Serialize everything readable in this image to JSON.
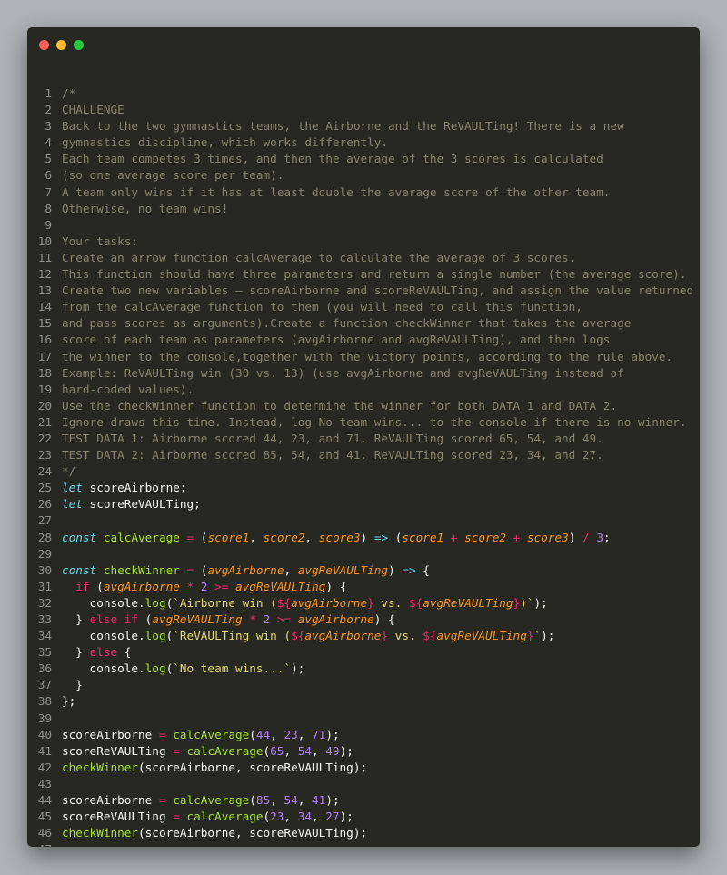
{
  "window_controls": {
    "close": "close-dot",
    "minimize": "minimize-dot",
    "zoom": "zoom-dot"
  },
  "colors": {
    "background": "#272822",
    "comment": "#88846f",
    "keyword": "#66d9ef",
    "operator": "#f92672",
    "function": "#a6e22e",
    "parameter": "#fd971f",
    "number": "#ae81ff",
    "string": "#e6db74",
    "plain": "#f8f8f2"
  },
  "code_lines": [
    [
      [
        "comment",
        "/*"
      ]
    ],
    [
      [
        "comment",
        "CHALLENGE"
      ]
    ],
    [
      [
        "comment",
        "Back to the two gymnastics teams, the Airborne and the ReVAULTing! There is a new"
      ]
    ],
    [
      [
        "comment",
        "gymnastics discipline, which works differently."
      ]
    ],
    [
      [
        "comment",
        "Each team competes 3 times, and then the average of the 3 scores is calculated"
      ]
    ],
    [
      [
        "comment",
        "(so one average score per team)."
      ]
    ],
    [
      [
        "comment",
        "A team only wins if it has at least double the average score of the other team."
      ]
    ],
    [
      [
        "comment",
        "Otherwise, no team wins!"
      ]
    ],
    [],
    [
      [
        "comment",
        "Your tasks:"
      ]
    ],
    [
      [
        "comment",
        "Create an arrow function calcAverage to calculate the average of 3 scores."
      ]
    ],
    [
      [
        "comment",
        "This function should have three parameters and return a single number (the average score)."
      ]
    ],
    [
      [
        "comment",
        "Create two new variables — scoreAirborne and scoreReVAULTing, and assign the value returned"
      ]
    ],
    [
      [
        "comment",
        "from the calcAverage function to them (you will need to call this function,"
      ]
    ],
    [
      [
        "comment",
        "and pass scores as arguments).Create a function checkWinner that takes the average"
      ]
    ],
    [
      [
        "comment",
        "score of each team as parameters (avgAirborne and avgReVAULTing), and then logs"
      ]
    ],
    [
      [
        "comment",
        "the winner to the console,together with the victory points, according to the rule above."
      ]
    ],
    [
      [
        "comment",
        "Example: ReVAULTing win (30 vs. 13) (use avgAirborne and avgReVAULTing instead of"
      ]
    ],
    [
      [
        "comment",
        "hard-coded values)."
      ]
    ],
    [
      [
        "comment",
        "Use the checkWinner function to determine the winner for both DATA 1 and DATA 2."
      ]
    ],
    [
      [
        "comment",
        "Ignore draws this time. Instead, log No team wins... to the console if there is no winner."
      ]
    ],
    [
      [
        "comment",
        "TEST DATA 1: Airborne scored 44, 23, and 71. ReVAULTing scored 65, 54, and 49."
      ]
    ],
    [
      [
        "comment",
        "TEST DATA 2: Airborne scored 85, 54, and 41. ReVAULTing scored 23, 34, and 27."
      ]
    ],
    [
      [
        "comment",
        "*/"
      ]
    ],
    [
      [
        "keyword",
        "let"
      ],
      [
        "plain",
        " scoreAirborne;"
      ]
    ],
    [
      [
        "keyword",
        "let"
      ],
      [
        "plain",
        " scoreReVAULTing;"
      ]
    ],
    [],
    [
      [
        "keyword",
        "const"
      ],
      [
        "plain",
        " "
      ],
      [
        "fn",
        "calcAverage"
      ],
      [
        "plain",
        " "
      ],
      [
        "op",
        "="
      ],
      [
        "plain",
        " ("
      ],
      [
        "param",
        "score1"
      ],
      [
        "plain",
        ", "
      ],
      [
        "param",
        "score2"
      ],
      [
        "plain",
        ", "
      ],
      [
        "param",
        "score3"
      ],
      [
        "plain",
        ") "
      ],
      [
        "arrow",
        "=>"
      ],
      [
        "plain",
        " ("
      ],
      [
        "param",
        "score1"
      ],
      [
        "plain",
        " "
      ],
      [
        "op",
        "+"
      ],
      [
        "plain",
        " "
      ],
      [
        "param",
        "score2"
      ],
      [
        "plain",
        " "
      ],
      [
        "op",
        "+"
      ],
      [
        "plain",
        " "
      ],
      [
        "param",
        "score3"
      ],
      [
        "plain",
        ") "
      ],
      [
        "op",
        "/"
      ],
      [
        "plain",
        " "
      ],
      [
        "num",
        "3"
      ],
      [
        "plain",
        ";"
      ]
    ],
    [],
    [
      [
        "keyword",
        "const"
      ],
      [
        "plain",
        " "
      ],
      [
        "fn",
        "checkWinner"
      ],
      [
        "plain",
        " "
      ],
      [
        "op",
        "="
      ],
      [
        "plain",
        " ("
      ],
      [
        "param",
        "avgAirborne"
      ],
      [
        "plain",
        ", "
      ],
      [
        "param",
        "avgReVAULTing"
      ],
      [
        "plain",
        ") "
      ],
      [
        "arrow",
        "=>"
      ],
      [
        "plain",
        " {"
      ]
    ],
    [
      [
        "plain",
        "  "
      ],
      [
        "ctrl",
        "if"
      ],
      [
        "plain",
        " ("
      ],
      [
        "param",
        "avgAirborne"
      ],
      [
        "plain",
        " "
      ],
      [
        "op",
        "*"
      ],
      [
        "plain",
        " "
      ],
      [
        "num",
        "2"
      ],
      [
        "plain",
        " "
      ],
      [
        "op",
        ">="
      ],
      [
        "plain",
        " "
      ],
      [
        "param",
        "avgReVAULTing"
      ],
      [
        "plain",
        ") {"
      ]
    ],
    [
      [
        "plain",
        "    console."
      ],
      [
        "fn",
        "log"
      ],
      [
        "plain",
        "("
      ],
      [
        "str",
        "`Airborne win ("
      ],
      [
        "tpl",
        "${"
      ],
      [
        "param",
        "avgAirborne"
      ],
      [
        "tpl",
        "}"
      ],
      [
        "str",
        " vs. "
      ],
      [
        "tpl",
        "${"
      ],
      [
        "param",
        "avgReVAULTing"
      ],
      [
        "tpl",
        "}"
      ],
      [
        "str",
        ")`"
      ],
      [
        "plain",
        ");"
      ]
    ],
    [
      [
        "plain",
        "  } "
      ],
      [
        "ctrl",
        "else"
      ],
      [
        "plain",
        " "
      ],
      [
        "ctrl",
        "if"
      ],
      [
        "plain",
        " ("
      ],
      [
        "param",
        "avgReVAULTing"
      ],
      [
        "plain",
        " "
      ],
      [
        "op",
        "*"
      ],
      [
        "plain",
        " "
      ],
      [
        "num",
        "2"
      ],
      [
        "plain",
        " "
      ],
      [
        "op",
        ">="
      ],
      [
        "plain",
        " "
      ],
      [
        "param",
        "avgAirborne"
      ],
      [
        "plain",
        ") {"
      ]
    ],
    [
      [
        "plain",
        "    console."
      ],
      [
        "fn",
        "log"
      ],
      [
        "plain",
        "("
      ],
      [
        "str",
        "`ReVAULTing win ("
      ],
      [
        "tpl",
        "${"
      ],
      [
        "param",
        "avgAirborne"
      ],
      [
        "tpl",
        "}"
      ],
      [
        "str",
        " vs. "
      ],
      [
        "tpl",
        "${"
      ],
      [
        "param",
        "avgReVAULTing"
      ],
      [
        "tpl",
        "}"
      ],
      [
        "str",
        "`"
      ],
      [
        "plain",
        ");"
      ]
    ],
    [
      [
        "plain",
        "  } "
      ],
      [
        "ctrl",
        "else"
      ],
      [
        "plain",
        " {"
      ]
    ],
    [
      [
        "plain",
        "    console."
      ],
      [
        "fn",
        "log"
      ],
      [
        "plain",
        "("
      ],
      [
        "str",
        "`No team wins...`"
      ],
      [
        "plain",
        ");"
      ]
    ],
    [
      [
        "plain",
        "  }"
      ]
    ],
    [
      [
        "plain",
        "};"
      ]
    ],
    [],
    [
      [
        "plain",
        "scoreAirborne "
      ],
      [
        "op",
        "="
      ],
      [
        "plain",
        " "
      ],
      [
        "fn",
        "calcAverage"
      ],
      [
        "plain",
        "("
      ],
      [
        "num",
        "44"
      ],
      [
        "plain",
        ", "
      ],
      [
        "num",
        "23"
      ],
      [
        "plain",
        ", "
      ],
      [
        "num",
        "71"
      ],
      [
        "plain",
        ");"
      ]
    ],
    [
      [
        "plain",
        "scoreReVAULTing "
      ],
      [
        "op",
        "="
      ],
      [
        "plain",
        " "
      ],
      [
        "fn",
        "calcAverage"
      ],
      [
        "plain",
        "("
      ],
      [
        "num",
        "65"
      ],
      [
        "plain",
        ", "
      ],
      [
        "num",
        "54"
      ],
      [
        "plain",
        ", "
      ],
      [
        "num",
        "49"
      ],
      [
        "plain",
        ");"
      ]
    ],
    [
      [
        "fn",
        "checkWinner"
      ],
      [
        "plain",
        "(scoreAirborne, scoreReVAULTing);"
      ]
    ],
    [],
    [
      [
        "plain",
        "scoreAirborne "
      ],
      [
        "op",
        "="
      ],
      [
        "plain",
        " "
      ],
      [
        "fn",
        "calcAverage"
      ],
      [
        "plain",
        "("
      ],
      [
        "num",
        "85"
      ],
      [
        "plain",
        ", "
      ],
      [
        "num",
        "54"
      ],
      [
        "plain",
        ", "
      ],
      [
        "num",
        "41"
      ],
      [
        "plain",
        ");"
      ]
    ],
    [
      [
        "plain",
        "scoreReVAULTing "
      ],
      [
        "op",
        "="
      ],
      [
        "plain",
        " "
      ],
      [
        "fn",
        "calcAverage"
      ],
      [
        "plain",
        "("
      ],
      [
        "num",
        "23"
      ],
      [
        "plain",
        ", "
      ],
      [
        "num",
        "34"
      ],
      [
        "plain",
        ", "
      ],
      [
        "num",
        "27"
      ],
      [
        "plain",
        ");"
      ]
    ],
    [
      [
        "fn",
        "checkWinner"
      ],
      [
        "plain",
        "(scoreAirborne, scoreReVAULTing);"
      ]
    ],
    []
  ]
}
